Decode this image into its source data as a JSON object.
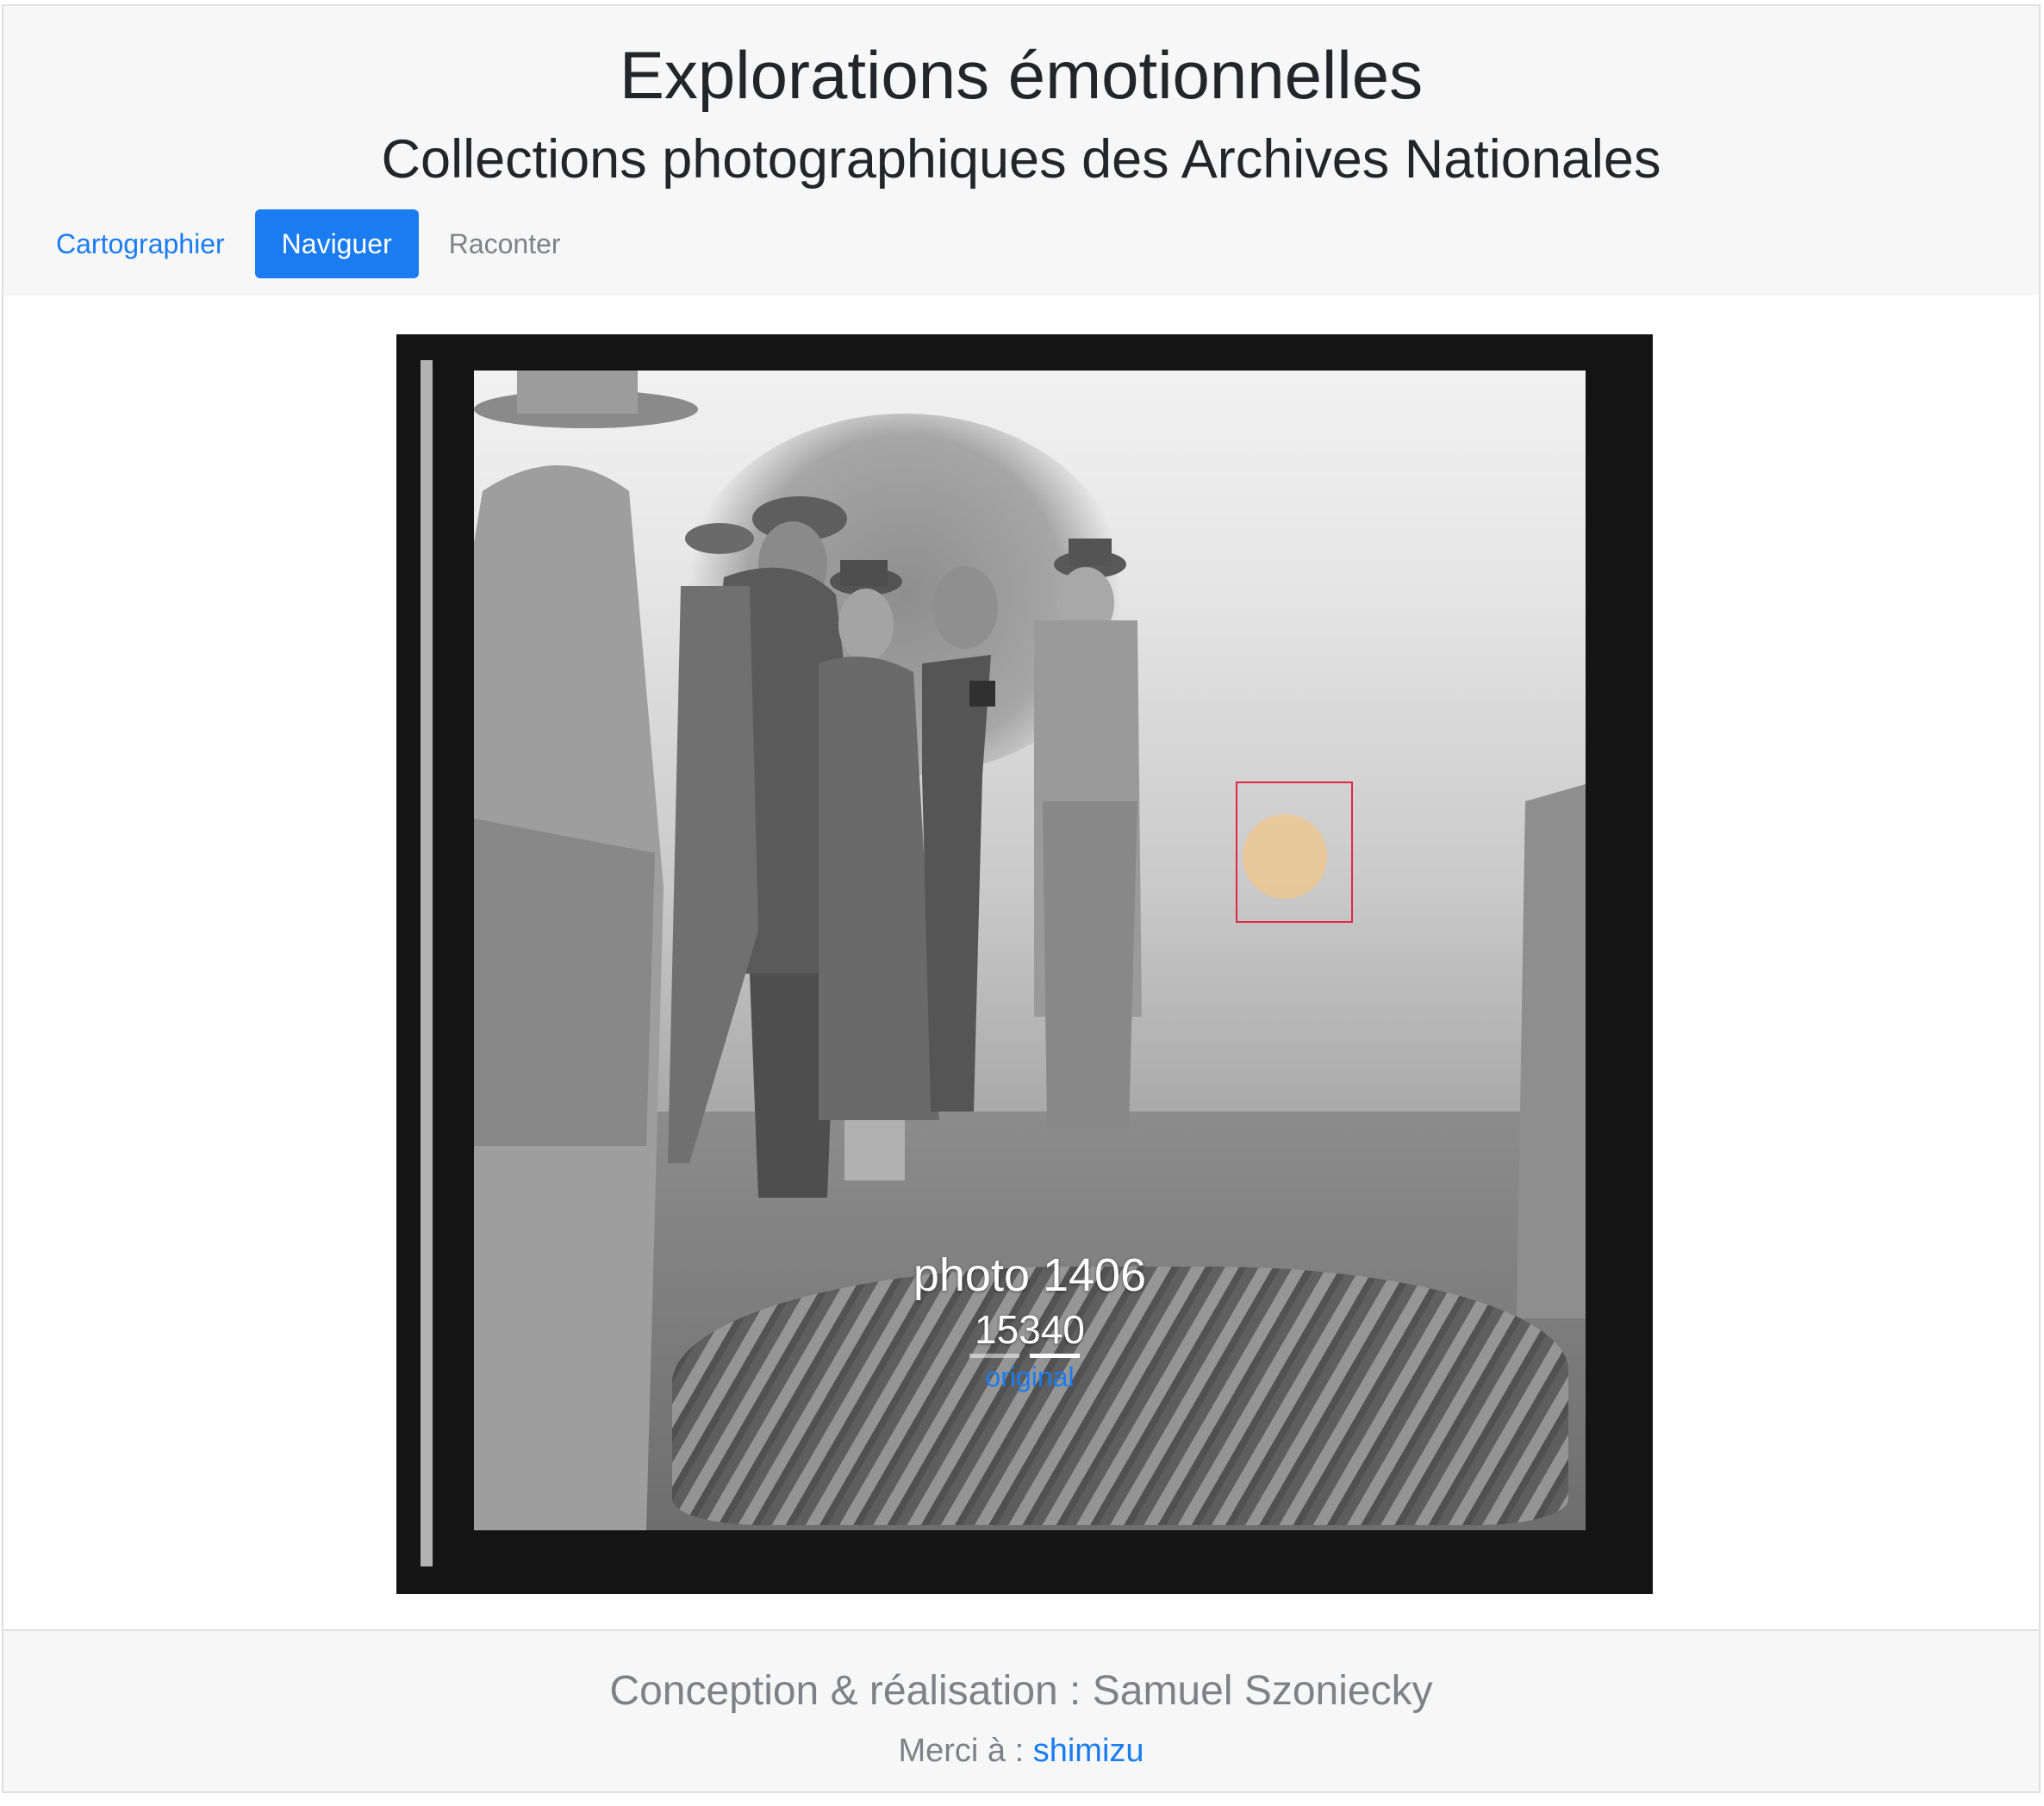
{
  "header": {
    "title": "Explorations émotionnelles",
    "subtitle": "Collections photographiques des Archives Nationales",
    "nav": [
      {
        "label": "Cartographier",
        "state": "link"
      },
      {
        "label": "Naviguer",
        "state": "active"
      },
      {
        "label": "Raconter",
        "state": "muted"
      }
    ]
  },
  "carousel": {
    "caption_title": "photo 1406",
    "caption_id": "15340",
    "link_label": "original",
    "indicator_count": 2,
    "active_indicator": 2
  },
  "footer": {
    "credit": "Conception & réalisation : Samuel Szoniecky",
    "thanks_prefix": "Merci à : ",
    "thanks_link": "shimizu"
  },
  "colors": {
    "accent": "#1a7cf0",
    "selection_box": "#e0274a",
    "selection_dot": "#f8c480"
  }
}
